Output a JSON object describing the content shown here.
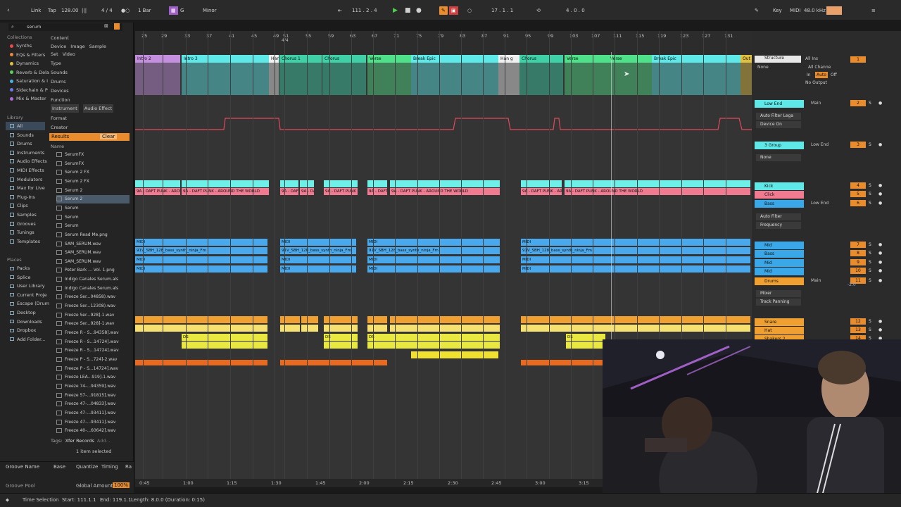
{
  "transport": {
    "link": "Link",
    "tap": "Tap",
    "tempo": "128.00",
    "signature": "4 / 4",
    "quantize": "1 Bar",
    "key_root": "G",
    "scale": "Minor",
    "position": "111 .  2 .  4",
    "loop_start": "17 .  1 .  1",
    "loop_length": "4 .  0 .  0",
    "key_label": "Key",
    "midi_label": "MIDI",
    "sample_rate": "48.0 kHz"
  },
  "browser": {
    "search_value": "serum",
    "collections_heading": "Collections",
    "collections": [
      {
        "label": "Synths",
        "color": "#e84a4a"
      },
      {
        "label": "EQs & Filters",
        "color": "#e8883a"
      },
      {
        "label": "Dynamics",
        "color": "#e0c040"
      },
      {
        "label": "Reverb & Dela",
        "color": "#5ad05a"
      },
      {
        "label": "Saturation & I",
        "color": "#4ab0e0"
      },
      {
        "label": "Sidechain & P",
        "color": "#6a7ae8"
      },
      {
        "label": "Mix & Master",
        "color": "#b06ae0"
      }
    ],
    "library_heading": "Library",
    "library": [
      "All",
      "Sounds",
      "Drums",
      "Instruments",
      "Audio Effects",
      "MIDI Effects",
      "Modulators",
      "Max for Live",
      "Plug-Ins",
      "Clips",
      "Samples",
      "Grooves",
      "Tunings",
      "Templates"
    ],
    "places_heading": "Places",
    "places": [
      "Packs",
      "Splice",
      "User Library",
      "Current Proje",
      "Escape (Drum",
      "Desktop",
      "Downloads",
      "Dropbox",
      "Add Folder..."
    ],
    "filters": {
      "content": "Content",
      "content_tags": [
        "Device",
        "Image",
        "Sample",
        "Set",
        "Video"
      ],
      "type": "Type",
      "sounds": "Sounds",
      "drums": "Drums",
      "devices": "Devices",
      "function": "Function",
      "function_tags": [
        "Instrument",
        "Audio Effect"
      ],
      "format": "Format",
      "creator": "Creator"
    },
    "results_label": "Results",
    "clear_label": "Clear",
    "name_column": "Name",
    "files": [
      "SerumFX",
      "SerumFX",
      "Serum 2 FX",
      "Serum 2 FX",
      "Serum 2",
      "Serum 2",
      "Serum",
      "Serum",
      "Serum",
      "Serum Read Me.png",
      "SAM_SERUM.wav",
      "SAM_SERUM.wav",
      "SAM_SERUM.wav",
      "Peter Bark ... Vol. 1.png",
      "Indigo Canales Serum.als",
      "Indigo Canales Serum.als",
      "Freeze Ser...04858).wav",
      "Freeze Ser...12308).wav",
      "Freeze Ser...928]-1.wav",
      "Freeze Ser...928]-1.wav",
      "Freeze R - S...94358].wav",
      "Freeze R - S...14724].wav",
      "Freeze R - S...14724].wav",
      "Freeze P - S...724]-2.wav",
      "Freeze P - S...14724].wav",
      "Freeze LEA...919]-1.wav",
      "Freeze 74-...94359].wav",
      "Freeze 57-...91815].wav",
      "Freeze 47-...04833].wav",
      "Freeze 47-...93411].wav",
      "Freeze 47-...93411].wav",
      "Freeze 40-...60642].wav"
    ],
    "tags_label": "Tags:",
    "tags_value": "Xfer Records",
    "tags_add": "Add...",
    "selected_info": "1 item selected"
  },
  "groove": {
    "columns": [
      "Groove Name",
      "Base",
      "Quantize",
      "Timing",
      "Ra"
    ],
    "pool_label": "Groove Pool",
    "global_amount_label": "Global Amount",
    "global_amount_value": "100%"
  },
  "ruler": {
    "bars": [
      "25",
      "29",
      "33",
      "37",
      "41",
      "45",
      "49",
      "51",
      "55",
      "59",
      "63",
      "67",
      "71",
      "75",
      "79",
      "83",
      "87",
      "91",
      "95",
      "99",
      "103",
      "107",
      "111",
      "115",
      "119",
      "123",
      "127",
      "131"
    ],
    "signature_marker": "4/4"
  },
  "sections": [
    {
      "label": "Intro 2",
      "color": "#c58fe0"
    },
    {
      "label": "Intro 3",
      "color": "#5ee8e8"
    },
    {
      "label": "Han",
      "color": "#f0f0f0"
    },
    {
      "label": "Chorus 1",
      "color": "#3fd0a8"
    },
    {
      "label": "Chorus",
      "color": "#3fd0a8"
    },
    {
      "label": "Verse",
      "color": "#4fe08a"
    },
    {
      "label": "Break Epic",
      "color": "#5ee8e8"
    },
    {
      "label": "Han g",
      "color": "#f0f0f0"
    },
    {
      "label": "Chorus",
      "color": "#3fd0a8"
    },
    {
      "label": "Verse",
      "color": "#4fe08a"
    },
    {
      "label": "Verse",
      "color": "#4fe08a"
    },
    {
      "label": "Break Epic",
      "color": "#5ee8e8"
    },
    {
      "label": "Out",
      "color": "#e0c040"
    }
  ],
  "clips": {
    "audio_label": "9A - DAFT PUNK - AROUND THE WORLD",
    "midi_label": "MIDI",
    "bass_label": "91V_SBH_128_bass_synth_ninja_Fm",
    "drum_label": "DS"
  },
  "mixer": {
    "structure_label": "Structure",
    "structure_input": "None",
    "all_ins": "All Ins",
    "all_channels": "All Channe",
    "monitor_in": "In",
    "monitor_auto": "Auto",
    "monitor_off": "Off",
    "output": "No Output",
    "tracks": [
      {
        "name": "Low End",
        "color": "#5ee8e8",
        "num": "2",
        "route": "Main"
      },
      {
        "name": "3 Group",
        "color": "#5ee8e8",
        "num": "3",
        "route": "Low End"
      },
      {
        "name": "Kick",
        "color": "#5ee8e8",
        "num": "4",
        "route": ""
      },
      {
        "name": "Click",
        "color": "#f07a90",
        "num": "5",
        "route": ""
      },
      {
        "name": "Bass",
        "color": "#3aa8e8",
        "num": "6",
        "route": "Low End"
      },
      {
        "name": "Mid",
        "color": "#3aa8e8",
        "num": "7",
        "route": ""
      },
      {
        "name": "Bass",
        "color": "#3aa8e8",
        "num": "8",
        "route": ""
      },
      {
        "name": "Mid",
        "color": "#3aa8e8",
        "num": "9",
        "route": ""
      },
      {
        "name": "Mid",
        "color": "#3aa8e8",
        "num": "10",
        "route": ""
      },
      {
        "name": "Drums",
        "color": "#f0a030",
        "num": "11",
        "route": "Main"
      },
      {
        "name": "Snare",
        "color": "#f0a030",
        "num": "12",
        "route": ""
      },
      {
        "name": "Hat",
        "color": "#f0a030",
        "num": "13",
        "route": ""
      },
      {
        "name": "Shakers 2",
        "color": "#f0a030",
        "num": "14",
        "route": ""
      }
    ],
    "devices": {
      "auto_filter_legacy": "Auto Filter Lega",
      "device_on": "Device On",
      "none": "None",
      "auto_filter": "Auto Filter",
      "frequency": "Frequency",
      "mixer": "Mixer",
      "track_panning": "Track Panning"
    },
    "db_value": "-2.0"
  },
  "time_axis": [
    "0:45",
    "1:00",
    "1:15",
    "1:30",
    "1:45",
    "2:00",
    "2:15",
    "2:30",
    "2:45",
    "3:00",
    "3:15"
  ],
  "status": {
    "mode": "Time Selection",
    "start": "Start: 111.1.1",
    "end": "End: 119.1.1",
    "length": "Length: 8.0.0 (Duration: 0:15)"
  }
}
